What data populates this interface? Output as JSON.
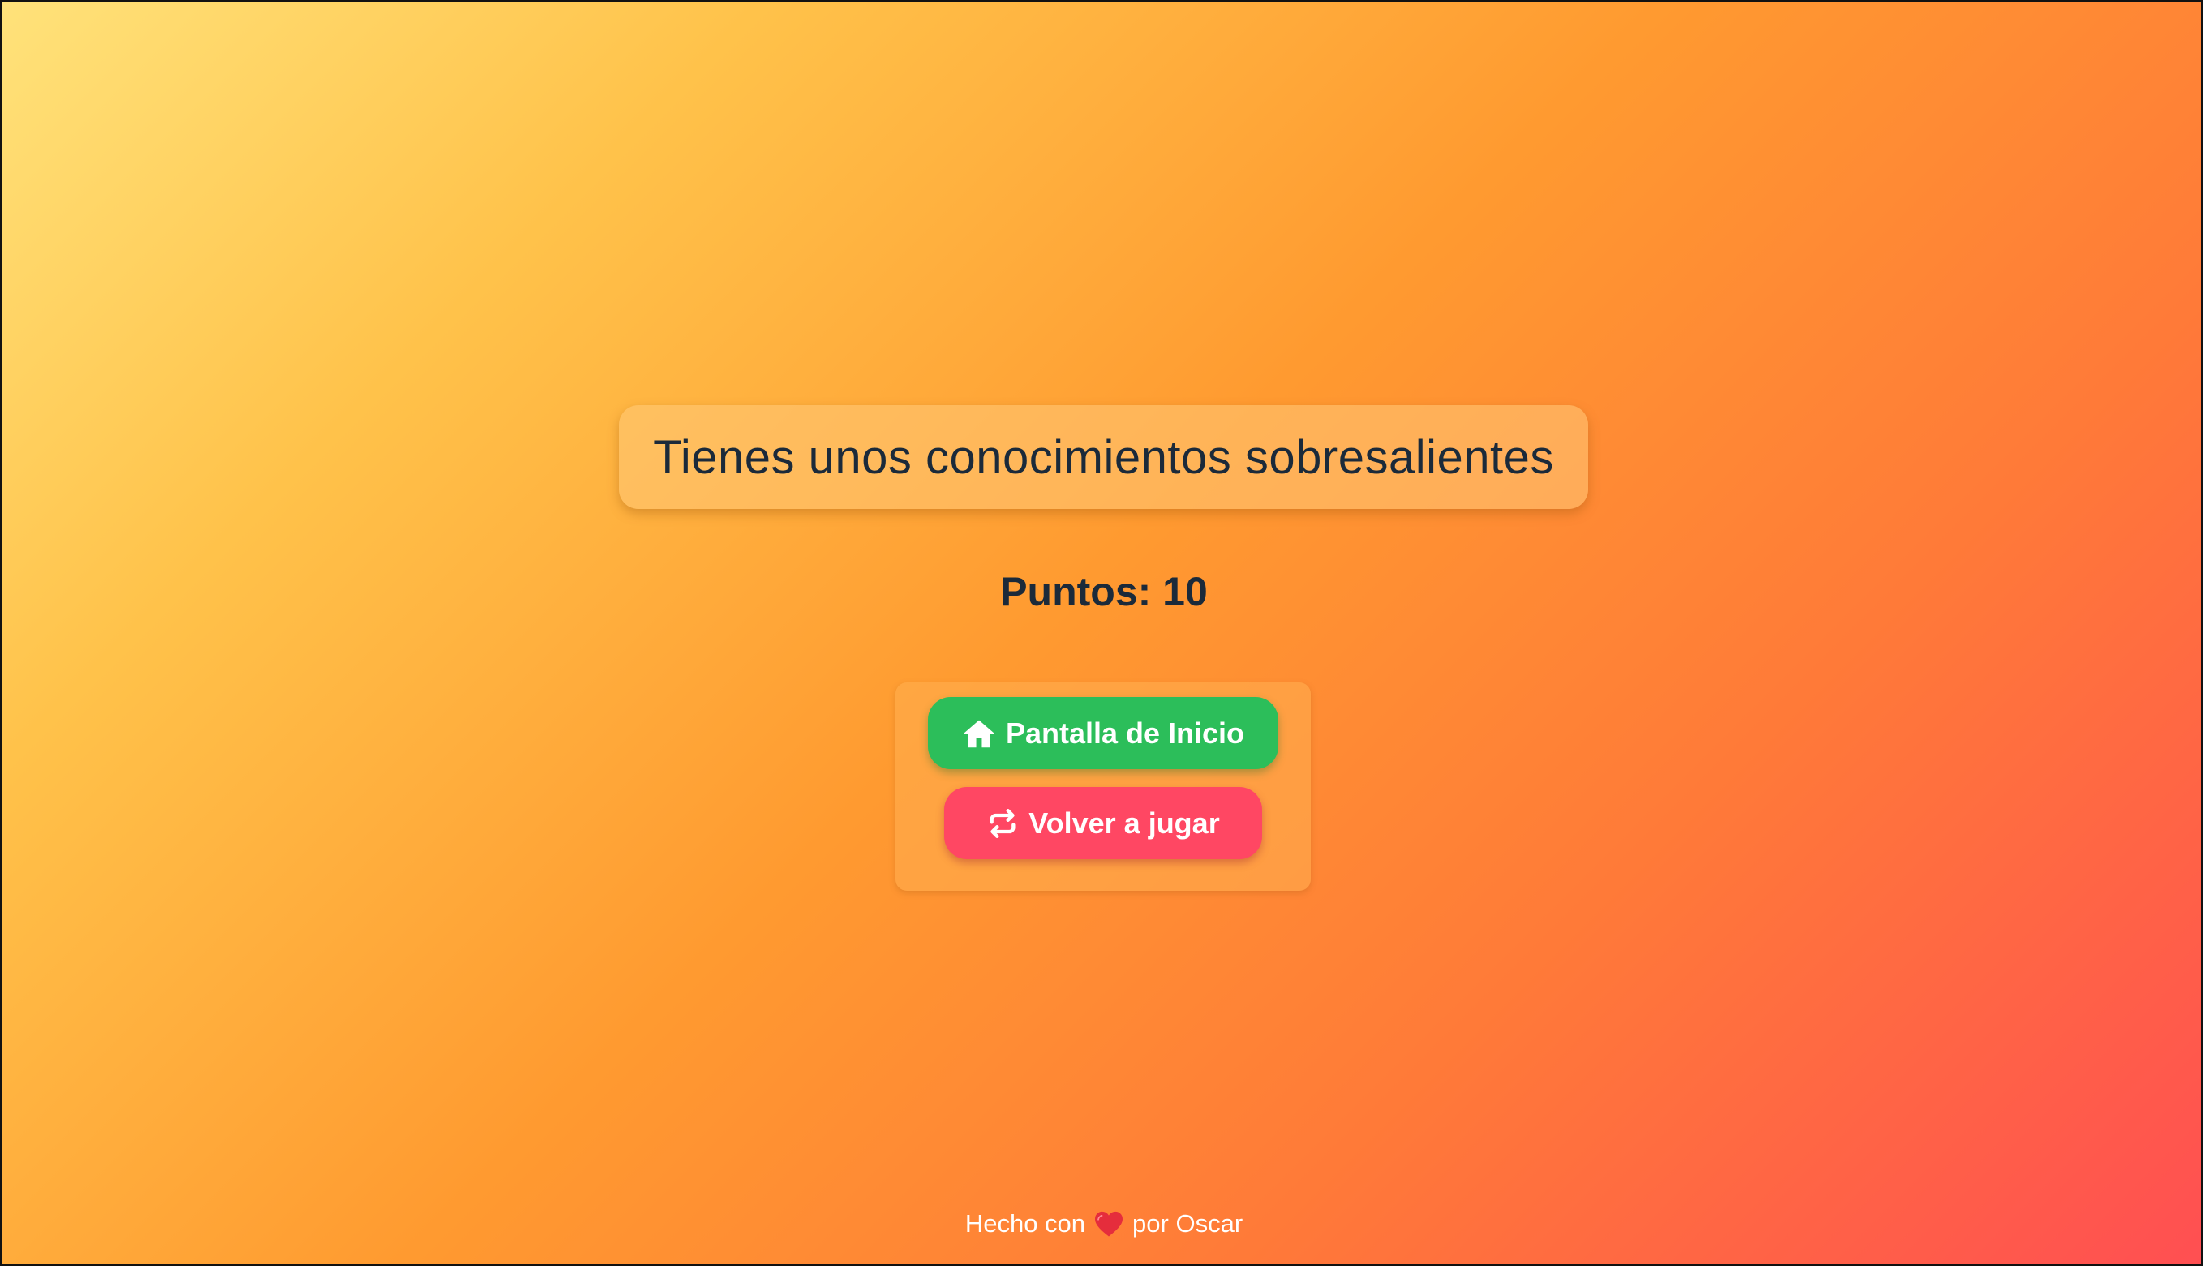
{
  "result": {
    "message": "Tienes unos conocimientos sobresalientes",
    "score_text": "Puntos: 10"
  },
  "actions": {
    "home_label": "Pantalla de Inicio",
    "home_icon": "home-icon",
    "replay_label": "Volver a jugar",
    "replay_icon": "repeat-icon"
  },
  "footer": {
    "prefix": "Hecho con",
    "icon": "heart-icon",
    "suffix": "por Oscar"
  },
  "colors": {
    "text_dark": "#1b2a3a",
    "home_button": "#2cbe5a",
    "replay_button": "#ff4763",
    "heart": "#e52d3c"
  }
}
